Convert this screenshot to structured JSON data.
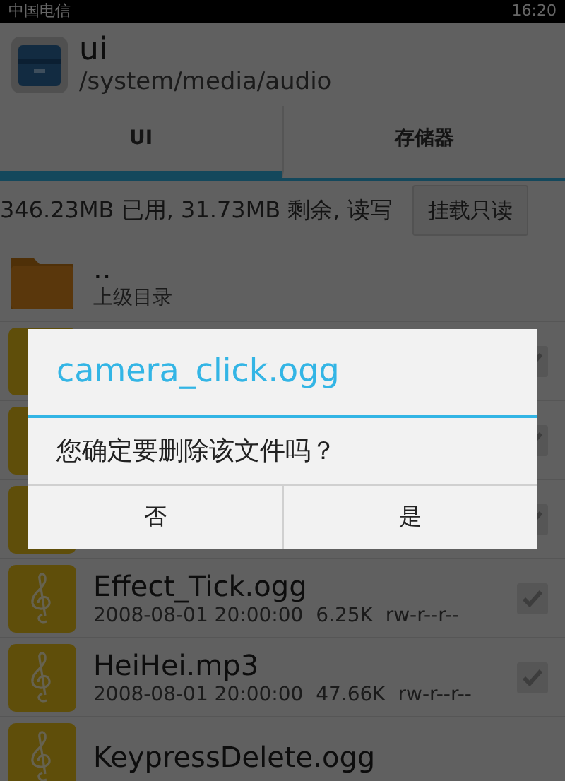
{
  "status_bar": {
    "carrier": "中国电信",
    "time": "16:20"
  },
  "header": {
    "title": "ui",
    "path": "/system/media/audio"
  },
  "tabs": [
    {
      "label": "UI",
      "selected": true
    },
    {
      "label": "存储器",
      "selected": false
    }
  ],
  "storage": {
    "summary": "346.23MB 已用, 31.73MB 剩余, 读写",
    "button": "挂载只读"
  },
  "files": [
    {
      "kind": "parent",
      "name": "..",
      "detail": "上级目录"
    },
    {
      "kind": "audio",
      "checked": false
    },
    {
      "kind": "audio",
      "checked": false
    },
    {
      "kind": "audio",
      "checked": false
    },
    {
      "kind": "audio",
      "name": "Effect_Tick.ogg",
      "detail": "2008-08-01 20:00:00  6.25K  rw-r--r--",
      "checked": false
    },
    {
      "kind": "audio",
      "name": "HeiHei.mp3",
      "detail": "2008-08-01 20:00:00  47.66K  rw-r--r--",
      "checked": false
    },
    {
      "kind": "audio",
      "name": "KeypressDelete.ogg"
    }
  ],
  "dialog": {
    "title": "camera_click.ogg",
    "message": "您确定要删除该文件吗？",
    "buttons": [
      "否",
      "是"
    ]
  }
}
